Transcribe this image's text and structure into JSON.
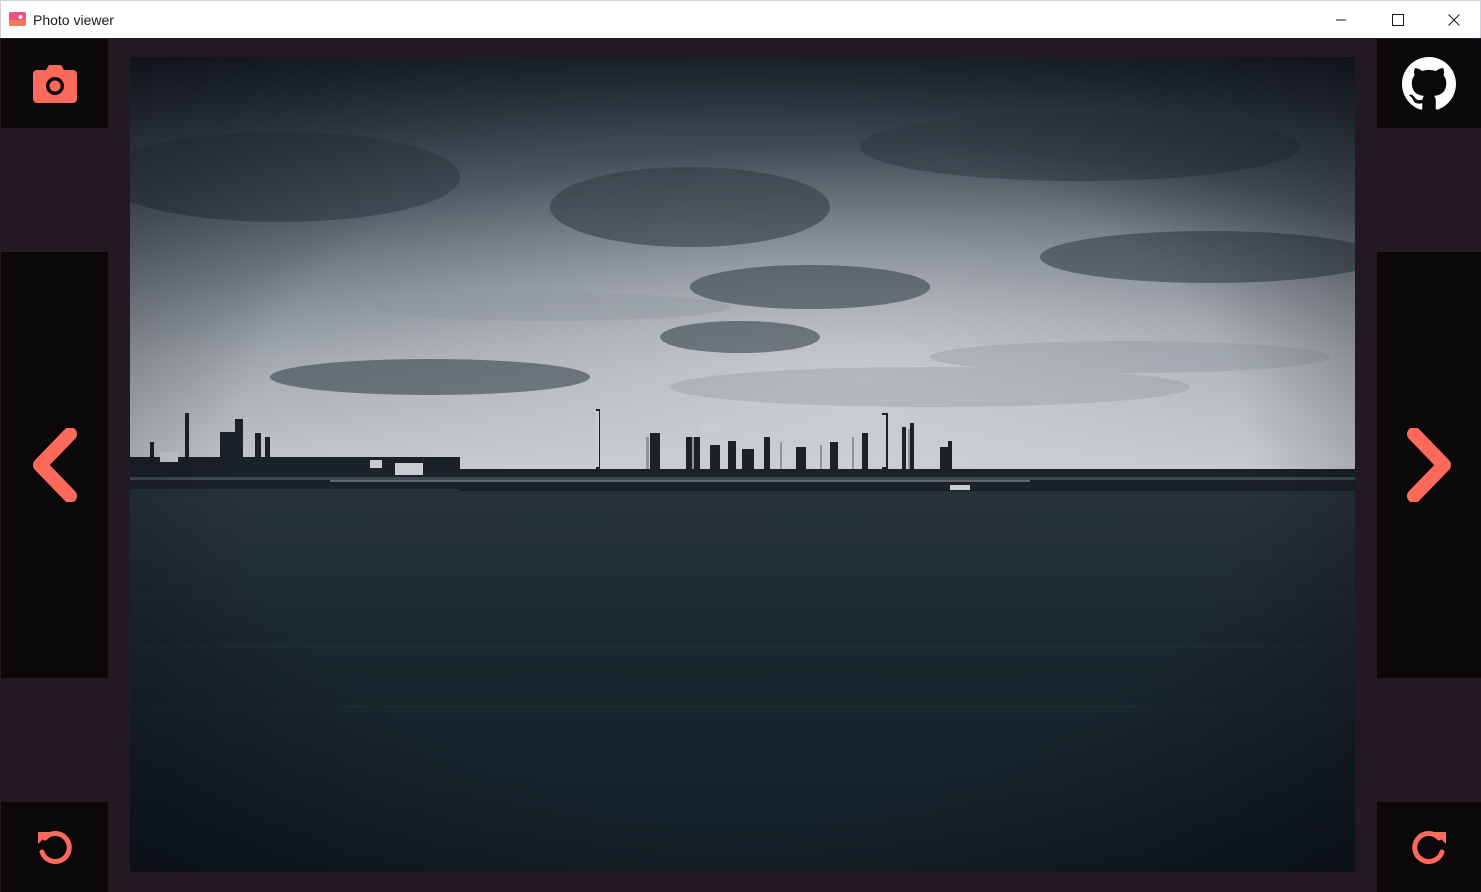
{
  "window": {
    "title": "Photo viewer"
  },
  "toolbar": {
    "left_top_icon": "camera-icon",
    "left_mid_icon": "chevron-left-icon",
    "left_bottom_icon": "rotate-left-icon",
    "right_top_icon": "github-icon",
    "right_mid_icon": "chevron-right-icon",
    "right_bottom_icon": "rotate-right-icon"
  },
  "colors": {
    "accent": "#fd6a5b",
    "panel": "#0b080a",
    "background": "#231a21"
  }
}
